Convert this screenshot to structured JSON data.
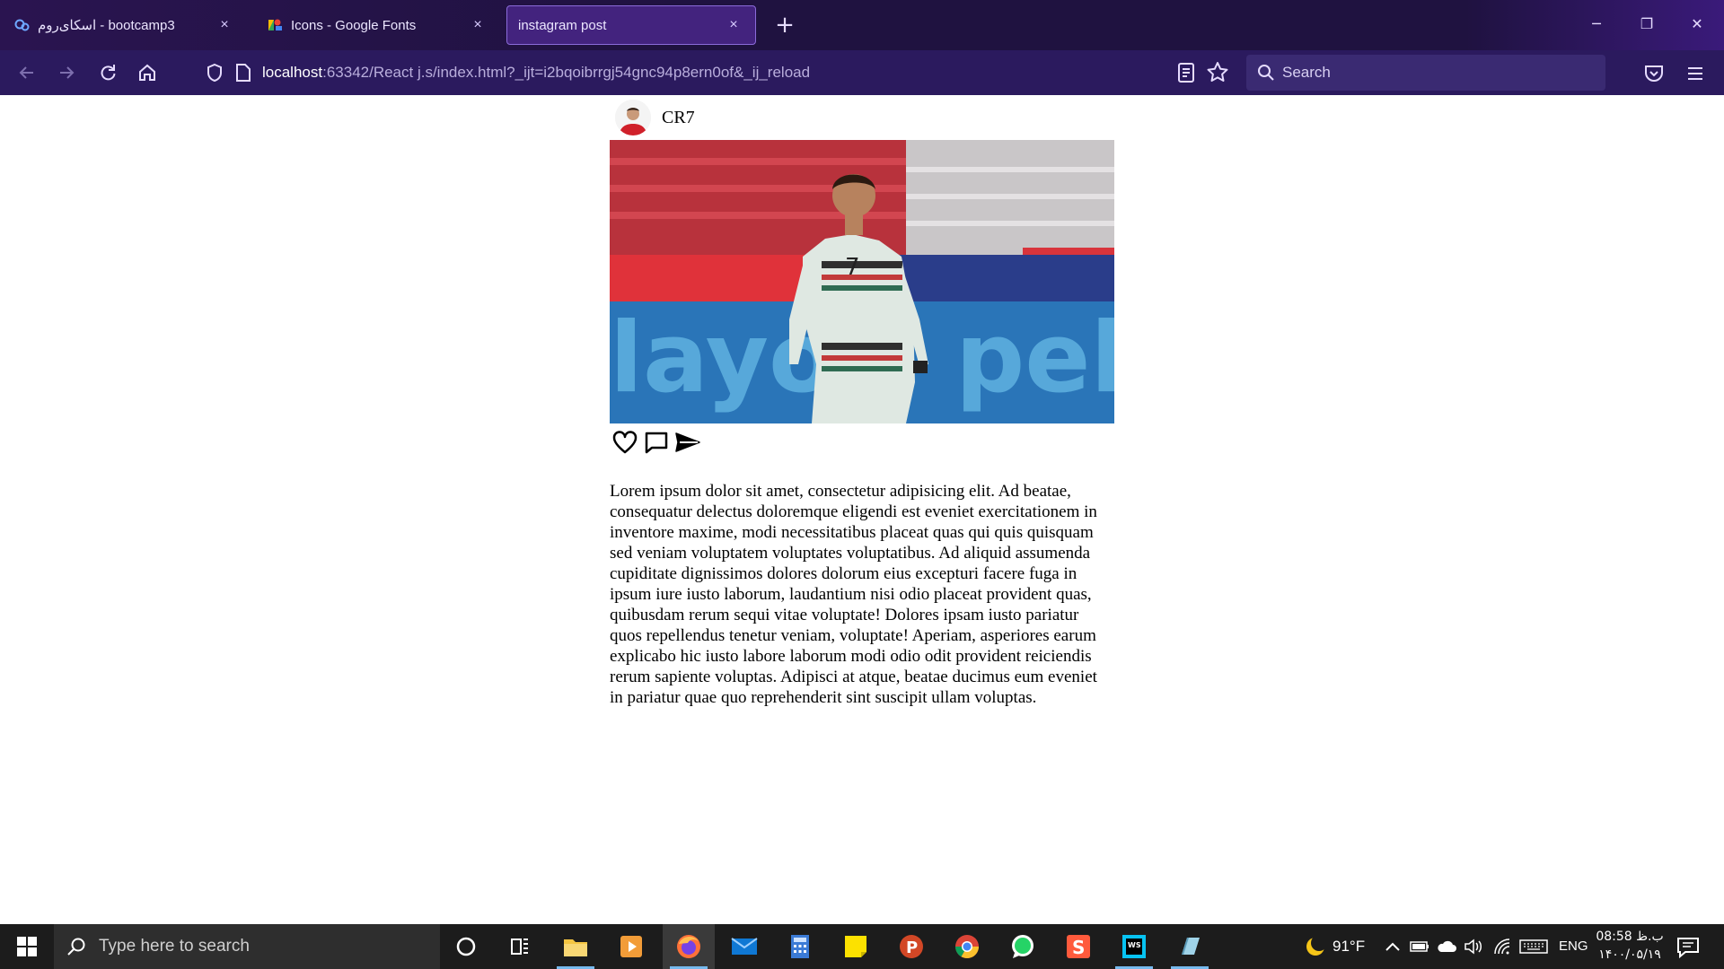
{
  "browser": {
    "tabs": [
      {
        "title": "اسکای‌روم - bootcamp3",
        "icon": "skyroom-icon",
        "active": false
      },
      {
        "title": "Icons - Google Fonts",
        "icon": "google-fonts-icon",
        "active": false
      },
      {
        "title": "instagram post",
        "icon": "",
        "active": true
      }
    ],
    "close_glyph": "×",
    "new_tab_glyph": "+",
    "window_controls": {
      "minimize": "─",
      "restore": "❐",
      "close": "✕"
    },
    "url_host": "localhost",
    "url_rest": ":63342/React j.s/index.html?_ijt=i2bqoibrrgj54gnc94p8ern0of&_ij_reload",
    "search_placeholder": "Search",
    "accent_color": "#8b6bd9"
  },
  "post": {
    "username": "CR7",
    "image_alt": "",
    "actions": [
      "heart-icon",
      "comment-icon",
      "send-icon"
    ],
    "caption": "Lorem ipsum dolor sit amet, consectetur adipisicing elit. Ad beatae, consequatur delectus doloremque eligendi est eveniet exercitationem in inventore maxime, modi necessitatibus placeat quas qui quis quisquam sed veniam voluptatem voluptates voluptatibus. Ad aliquid assumenda cupiditate dignissimos dolores dolorum eius excepturi facere fuga in ipsum iure iusto laborum, laudantium nisi odio placeat provident quas, quibusdam rerum sequi vitae voluptate! Dolores ipsam iusto pariatur quos repellendus tenetur veniam, voluptate! Aperiam, asperiores earum explicabo hic iusto labore laborum modi odio odit provident reiciendis rerum sapiente voluptas. Adipisci at atque, beatae ducimus eum eveniet in pariatur quae quo reprehenderit sint suscipit ullam voluptas."
  },
  "taskbar": {
    "search_placeholder": "Type here to search",
    "apps": [
      "cortana-icon",
      "task-view-icon",
      "file-explorer-icon",
      "video-player-icon",
      "firefox-icon",
      "mail-icon",
      "calculator-icon",
      "sticky-notes-icon",
      "powerpoint-icon",
      "chrome-icon",
      "whatsapp-icon",
      "sublime-icon",
      "webstorm-icon",
      "app-icon"
    ],
    "weather_temp": "91°F",
    "language": "ENG",
    "clock_time": "08:58 ب.ظ",
    "clock_date": "۱۴۰۰/۰۵/۱۹"
  }
}
